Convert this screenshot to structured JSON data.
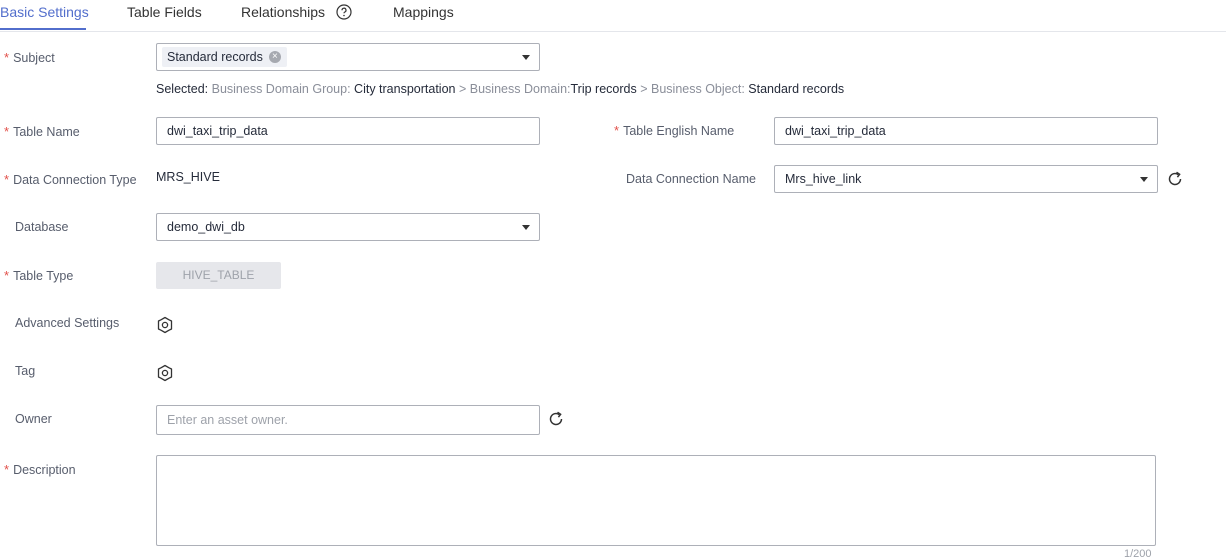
{
  "tabs": [
    {
      "label": "Basic Settings",
      "active": true
    },
    {
      "label": "Table Fields",
      "active": false
    },
    {
      "label": "Relationships",
      "active": false
    },
    {
      "label": "Mappings",
      "active": false
    }
  ],
  "form": {
    "required_mark": "*",
    "subject": {
      "label": "Subject",
      "chip": "Standard records",
      "selected_prefix": "Selected:",
      "group_label": "Business Domain Group:",
      "group_value": "City transportation",
      "sep": ">",
      "domain_label": "Business Domain:",
      "domain_value": "Trip records",
      "object_label": "Business Object:",
      "object_value": "Standard records"
    },
    "table_name": {
      "label": "Table Name",
      "value": "dwi_taxi_trip_data"
    },
    "table_english_name": {
      "label": "Table English Name",
      "value": "dwi_taxi_trip_data"
    },
    "data_connection_type": {
      "label": "Data Connection Type",
      "value": "MRS_HIVE"
    },
    "data_connection_name": {
      "label": "Data Connection Name",
      "value": "Mrs_hive_link"
    },
    "database": {
      "label": "Database",
      "value": "demo_dwi_db"
    },
    "table_type": {
      "label": "Table Type",
      "value": "HIVE_TABLE"
    },
    "advanced_settings": {
      "label": "Advanced Settings"
    },
    "tag": {
      "label": "Tag"
    },
    "owner": {
      "label": "Owner",
      "placeholder": "Enter an asset owner."
    },
    "description": {
      "label": "Description",
      "counter": "1/200"
    }
  },
  "colors": {
    "accent": "#526ecc",
    "required": "#e2504a",
    "border": "#adb0b8"
  },
  "icons": [
    "chevron-down-icon",
    "clear-icon",
    "refresh-icon",
    "gear-icon",
    "help-icon"
  ]
}
